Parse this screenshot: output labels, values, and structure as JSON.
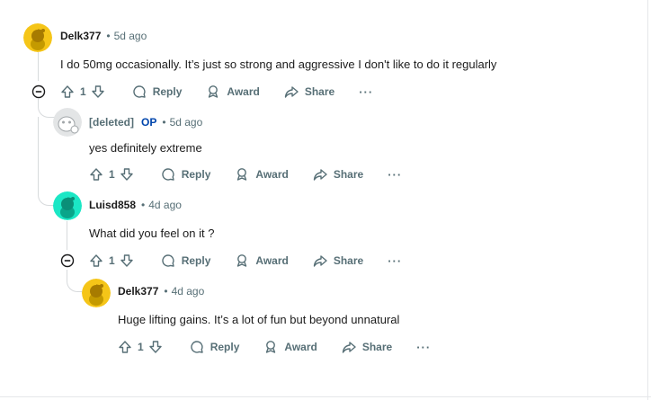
{
  "comments": [
    {
      "author": "Delk377",
      "time": "5d ago",
      "body": "I do 50mg occasionally. It’s just so strong and aggressive I don't like to do it regularly",
      "votes": "1",
      "avatar_color": "#f5c518"
    },
    {
      "author": "[deleted]",
      "op_badge": "OP",
      "time": "5d ago",
      "body": "yes definitely extreme",
      "votes": "1",
      "avatar_color": "#d7dadc"
    },
    {
      "author": "Luisd858",
      "time": "4d ago",
      "body": "What did you feel on it ?",
      "votes": "1",
      "avatar_color": "#1be7c5"
    },
    {
      "author": "Delk377",
      "time": "4d ago",
      "body": "Huge lifting gains. It’s a lot of fun but beyond unnatural",
      "votes": "1",
      "avatar_color": "#f5c518"
    }
  ],
  "actions": {
    "reply": "Reply",
    "award": "Award",
    "share": "Share",
    "more": "···"
  },
  "icons": {
    "upvote": "arrow-up-icon",
    "downvote": "arrow-down-icon",
    "reply": "speech-bubble-icon",
    "award": "award-icon",
    "share": "share-arrow-icon",
    "collapse": "minus-circle-icon"
  }
}
